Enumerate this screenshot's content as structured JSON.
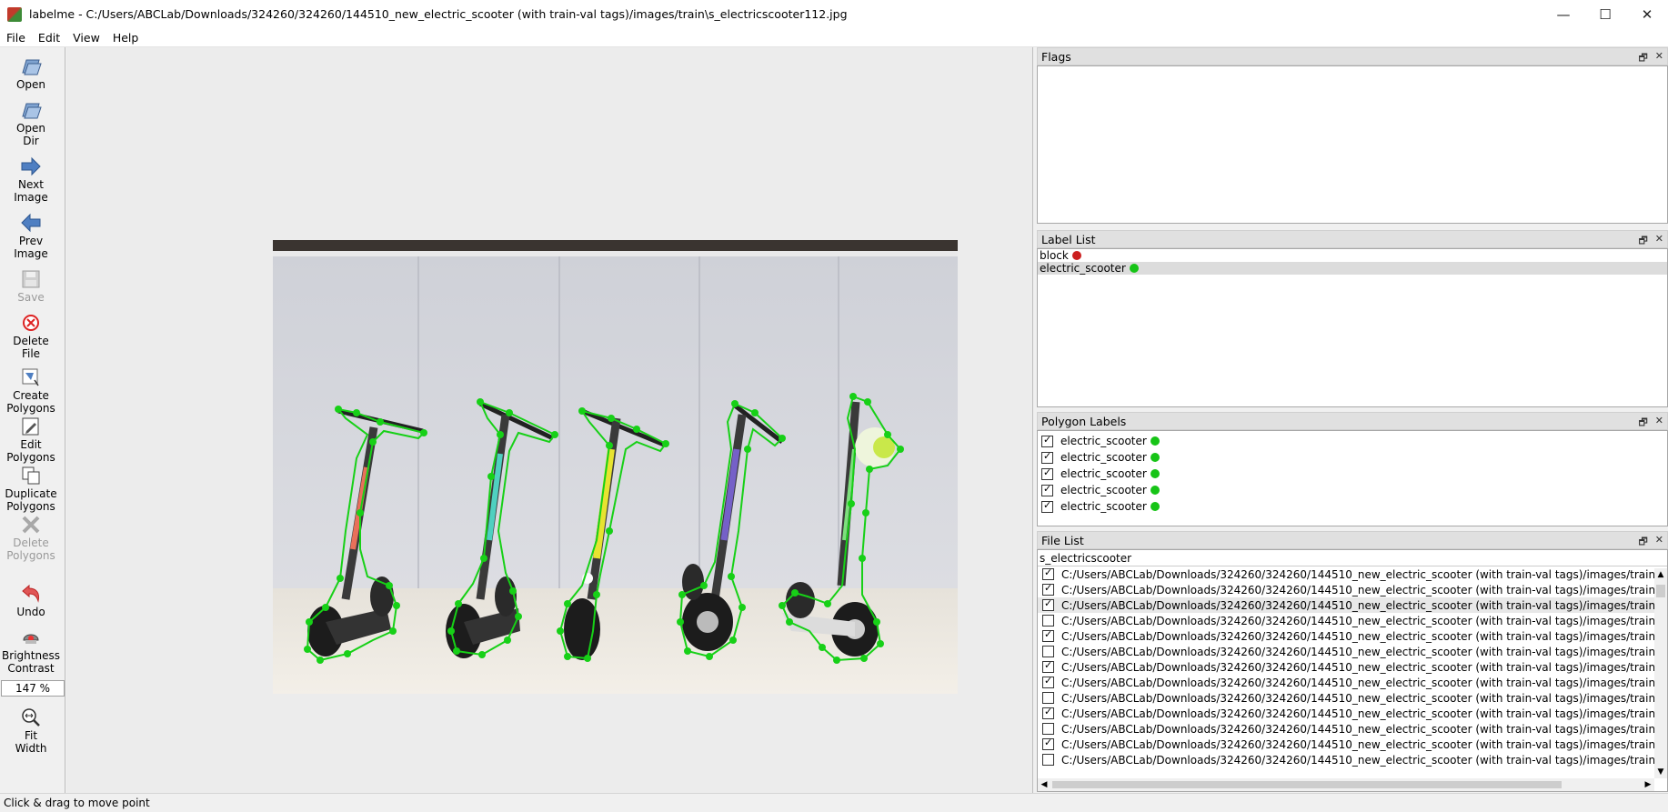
{
  "window": {
    "title": "labelme - C:/Users/ABCLab/Downloads/324260/324260/144510_new_electric_scooter (with train-val tags)/images/train\\s_electricscooter112.jpg",
    "minimize": "—",
    "maximize": "☐",
    "close": "✕"
  },
  "menu": [
    "File",
    "Edit",
    "View",
    "Help"
  ],
  "toolbar": {
    "open": "Open",
    "open_dir": [
      "Open",
      "Dir"
    ],
    "next_image": [
      "Next",
      "Image"
    ],
    "prev_image": [
      "Prev",
      "Image"
    ],
    "save": "Save",
    "delete_file": [
      "Delete",
      "File"
    ],
    "create_polygons": [
      "Create",
      "Polygons"
    ],
    "edit_polygons": [
      "Edit",
      "Polygons"
    ],
    "duplicate_polygons": [
      "Duplicate",
      "Polygons"
    ],
    "delete_polygons": [
      "Delete",
      "Polygons"
    ],
    "undo": "Undo",
    "brightness_contrast": [
      "Brightness",
      "Contrast"
    ],
    "zoom": "147 %",
    "fit_width": [
      "Fit",
      "Width"
    ]
  },
  "docks": {
    "flags": {
      "title": "Flags"
    },
    "label_list": {
      "title": "Label List",
      "items": [
        {
          "label": "block",
          "color": "#cc1f1f"
        },
        {
          "label": "electric_scooter",
          "color": "#17c417"
        }
      ]
    },
    "polygon_labels": {
      "title": "Polygon Labels",
      "items": [
        {
          "label": "electric_scooter",
          "checked": true,
          "color": "#17c417"
        },
        {
          "label": "electric_scooter",
          "checked": true,
          "color": "#17c417"
        },
        {
          "label": "electric_scooter",
          "checked": true,
          "color": "#17c417"
        },
        {
          "label": "electric_scooter",
          "checked": true,
          "color": "#17c417"
        },
        {
          "label": "electric_scooter",
          "checked": true,
          "color": "#17c417"
        }
      ]
    },
    "file_list": {
      "title": "File List",
      "search_value": "s_electricscooter",
      "path": "C:/Users/ABCLab/Downloads/324260/324260/144510_new_electric_scooter (with train-val tags)/images/train\\s_electricscooter",
      "checked": [
        true,
        true,
        true,
        false,
        true,
        false,
        true,
        true,
        false,
        true,
        false,
        true,
        false
      ],
      "selected_index": 2
    }
  },
  "status": "Click & drag to move point"
}
